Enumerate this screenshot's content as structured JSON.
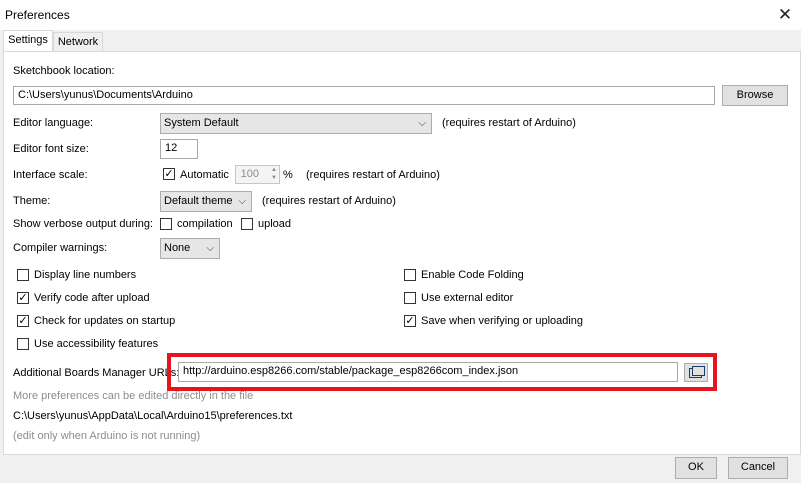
{
  "window": {
    "title": "Preferences",
    "close_glyph": "✕"
  },
  "tabs": [
    "Settings",
    "Network"
  ],
  "sketchbook": {
    "label": "Sketchbook location:",
    "value": "C:\\Users\\yunus\\Documents\\Arduino",
    "browse_label": "Browse"
  },
  "editor_language": {
    "label": "Editor language:",
    "value": "System Default",
    "note": "(requires restart of Arduino)"
  },
  "editor_font_size": {
    "label": "Editor font size:",
    "value": "12"
  },
  "interface_scale": {
    "label": "Interface scale:",
    "automatic_label": "Automatic",
    "automatic_checked": true,
    "value": "100",
    "unit": "%",
    "note": "(requires restart of Arduino)"
  },
  "theme": {
    "label": "Theme:",
    "value": "Default theme",
    "note": "(requires restart of Arduino)"
  },
  "verbose": {
    "label": "Show verbose output during:",
    "compilation_label": "compilation",
    "compilation_checked": false,
    "upload_label": "upload",
    "upload_checked": false
  },
  "compiler_warnings": {
    "label": "Compiler warnings:",
    "value": "None"
  },
  "options_left": [
    {
      "label": "Display line numbers",
      "checked": false
    },
    {
      "label": "Verify code after upload",
      "checked": true
    },
    {
      "label": "Check for updates on startup",
      "checked": true
    },
    {
      "label": "Use accessibility features",
      "checked": false
    }
  ],
  "options_right": [
    {
      "label": "Enable Code Folding",
      "checked": false
    },
    {
      "label": "Use external editor",
      "checked": false
    },
    {
      "label": "Save when verifying or uploading",
      "checked": true
    }
  ],
  "boards_manager": {
    "label": "Additional Boards Manager URLs:",
    "value": "http://arduino.esp8266.com/stable/package_esp8266com_index.json"
  },
  "footer": {
    "more_prefs": "More preferences can be edited directly in the file",
    "prefs_path": "C:\\Users\\yunus\\AppData\\Local\\Arduino15\\preferences.txt",
    "edit_note": "(edit only when Arduino is not running)"
  },
  "buttons": {
    "ok": "OK",
    "cancel": "Cancel"
  },
  "icons": {
    "checkmark": "✓",
    "chevron_down": "⌵",
    "spin_up": "▲",
    "spin_down": "▼"
  },
  "colors": {
    "highlight": "#e8131f"
  }
}
